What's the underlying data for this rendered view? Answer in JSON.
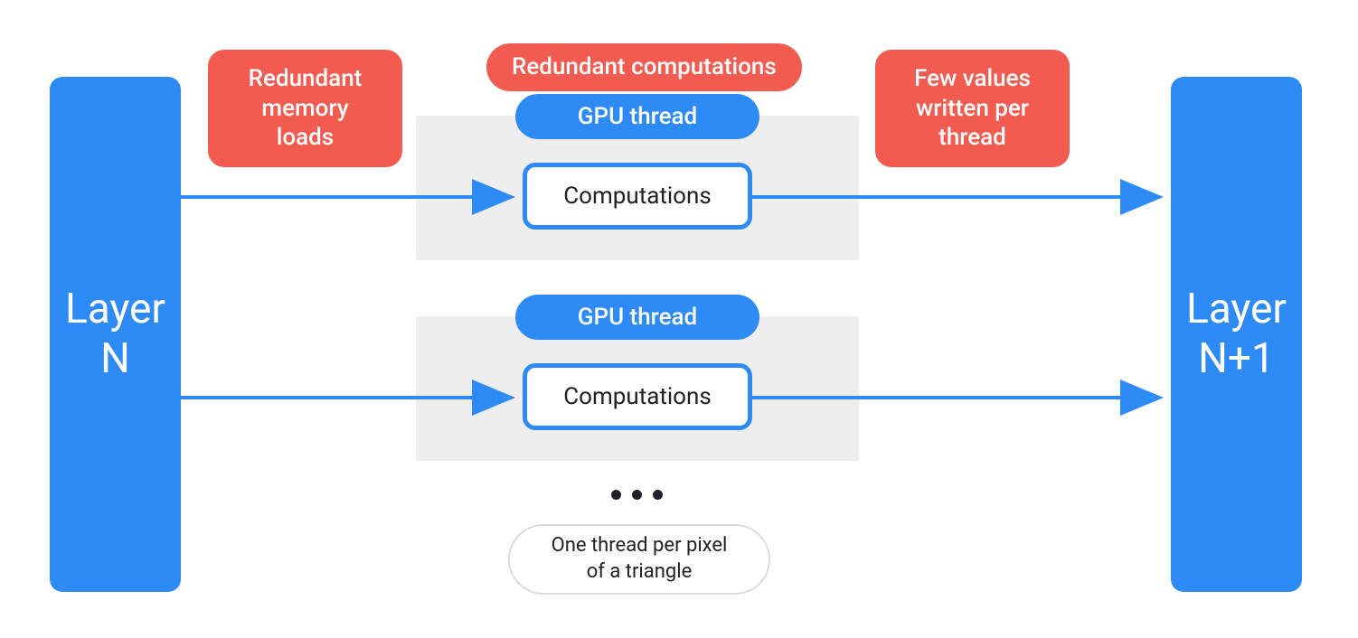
{
  "colors": {
    "blue": "#2e8bf6",
    "red": "#f25b50",
    "grey_bg": "#eeeeee",
    "border_grey": "#dadce0",
    "text_dark": "#202124",
    "white": "#ffffff"
  },
  "layers": {
    "left": "Layer\nN",
    "right": "Layer\nN+1"
  },
  "callouts": {
    "redundant_memory": "Redundant\nmemory\nloads",
    "redundant_computations": "Redundant computations",
    "few_values": "Few values\nwritten per\nthread"
  },
  "threads": {
    "gpu_thread_label": "GPU thread",
    "computations_label": "Computations"
  },
  "footnote": "One thread per pixel\nof a triangle",
  "ellipsis": "•••"
}
